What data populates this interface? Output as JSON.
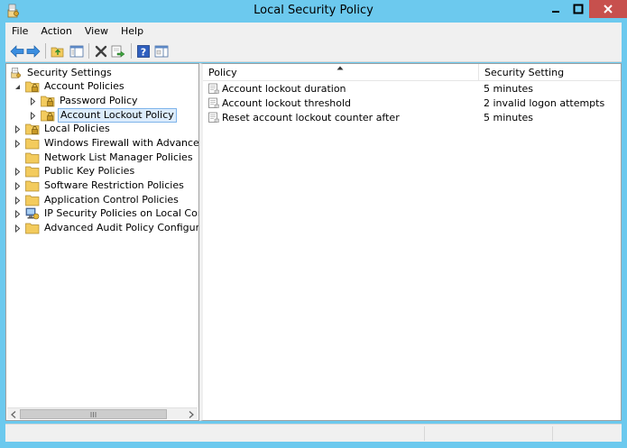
{
  "window": {
    "title": "Local Security Policy"
  },
  "menu": {
    "items": [
      "File",
      "Action",
      "View",
      "Help"
    ]
  },
  "toolbar": {
    "buttons": [
      "back-icon",
      "forward-icon",
      "up-folder-icon",
      "show-hide-tree-icon",
      "delete-icon",
      "export-list-icon",
      "help-icon",
      "properties-pane-icon"
    ]
  },
  "tree": {
    "items": [
      {
        "label": "Security Settings",
        "level": 0,
        "expander": "none"
      },
      {
        "label": "Account Policies",
        "level": 1,
        "expander": "expanded"
      },
      {
        "label": "Password Policy",
        "level": 2,
        "expander": "collapsed"
      },
      {
        "label": "Account Lockout Policy",
        "level": 2,
        "expander": "collapsed",
        "selected": true
      },
      {
        "label": "Local Policies",
        "level": 1,
        "expander": "collapsed"
      },
      {
        "label": "Windows Firewall with Advanced Secu",
        "level": 1,
        "expander": "collapsed"
      },
      {
        "label": "Network List Manager Policies",
        "level": 1,
        "expander": "none"
      },
      {
        "label": "Public Key Policies",
        "level": 1,
        "expander": "collapsed"
      },
      {
        "label": "Software Restriction Policies",
        "level": 1,
        "expander": "collapsed"
      },
      {
        "label": "Application Control Policies",
        "level": 1,
        "expander": "collapsed"
      },
      {
        "label": "IP Security Policies on Local Compute",
        "level": 1,
        "expander": "collapsed"
      },
      {
        "label": "Advanced Audit Policy Configuration",
        "level": 1,
        "expander": "collapsed"
      }
    ]
  },
  "list": {
    "columns": [
      "Policy",
      "Security Setting"
    ],
    "rows": [
      {
        "policy": "Account lockout duration",
        "setting": "5 minutes"
      },
      {
        "policy": "Account lockout threshold",
        "setting": "2 invalid logon attempts"
      },
      {
        "policy": "Reset account lockout counter after",
        "setting": "5 minutes"
      }
    ]
  },
  "colors": {
    "titlebar": "#6cc9ee",
    "close_button": "#c7504d",
    "selection_bg": "#dcecfc",
    "selection_border": "#7eb4ea"
  }
}
